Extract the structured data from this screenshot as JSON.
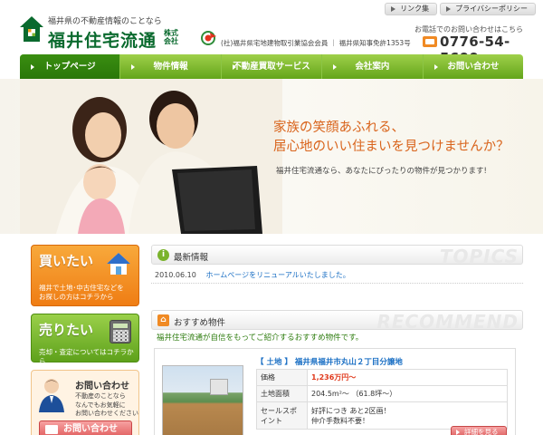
{
  "header": {
    "tagline": "福井県の不動産情報のことなら",
    "company_name": "福井住宅流通",
    "company_suffix": "株式会社",
    "association": "(社)福井県宅地建物取引業協会会員 ｜ 福井県知事免許1353号",
    "toplinks": [
      "リンク集",
      "プライバシーポリシー"
    ],
    "phone_label": "お電話でのお問い合わせはこちら",
    "phone_number": "0776-54-5600"
  },
  "nav": {
    "items": [
      "トップページ",
      "物件情報",
      "不動産買取サービス",
      "会社案内",
      "お問い合わせ"
    ],
    "active_index": 0
  },
  "hero": {
    "headline_1": "家族の笑顔あふれる、",
    "headline_2": "居心地のいい住まいを見つけませんか？",
    "sub": "福井住宅流通なら、あなたにぴったりの物件が見つかります!"
  },
  "sidebar": {
    "buy": {
      "title": "買いたい",
      "desc_1": "福井で土地･中古住宅などを",
      "desc_2": "お探しの方はコチラから"
    },
    "sell": {
      "title": "売りたい",
      "desc": "売却・査定についてはコチラから"
    },
    "contact": {
      "title": "お問い合わせ",
      "desc_1": "不動産のことなら",
      "desc_2": "なんでもお気軽に",
      "desc_3": "お問い合わせください",
      "button": "お問い合わせ"
    }
  },
  "topics": {
    "title": "最新情報",
    "watermark": "TOPICS",
    "items": [
      {
        "date": "2010.06.10",
        "text": "ホームページをリニューアルいたしました。"
      }
    ]
  },
  "recommend": {
    "title": "おすすめ物件",
    "watermark": "RECOMMEND",
    "intro": "福井住宅流通が自信をもってご紹介するおすすめ物件です。",
    "property": {
      "title": "【 土地 】 福井県福井市丸山２丁目分譲地",
      "rows": [
        {
          "label": "価格",
          "value": "1,236万円～"
        },
        {
          "label": "土地面積",
          "value": "204.5m²～ （61.8坪～）"
        },
        {
          "label": "セールスポイント",
          "value_1": "好評につき あと2区画！",
          "value_2": "仲介手数料不要！"
        }
      ],
      "detail_button": "詳細を見る"
    }
  },
  "colors": {
    "brand_green": "#0a6a2e",
    "nav_green": "#63a51a",
    "accent_orange": "#d9641c",
    "link_blue": "#1a6fc4",
    "price_red": "#e0381b"
  }
}
